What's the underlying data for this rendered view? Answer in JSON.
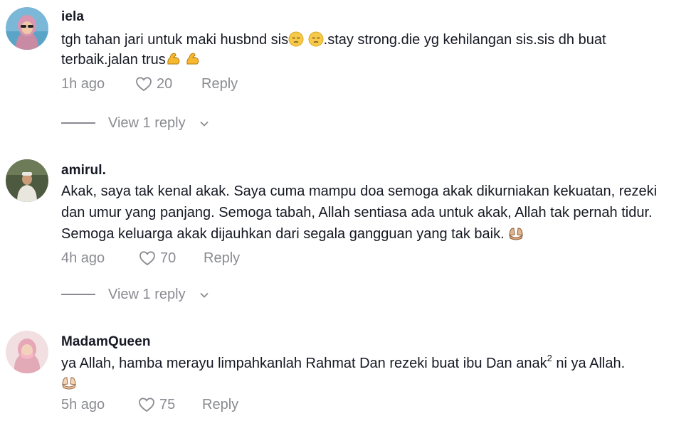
{
  "comments": [
    {
      "username": "iela",
      "text_part1": "tgh tahan jari untuk maki husbnd sis",
      "text_part2": ".stay strong.die yg kehilangan sis.sis dh buat terbaik.jalan trus",
      "time": "1h ago",
      "likes": "20",
      "reply_label": "Reply",
      "view_replies": "View 1 reply"
    },
    {
      "username": "amirul.",
      "text": "Akak, saya tak kenal akak. Saya cuma mampu doa semoga akak dikurniakan kekuatan, rezeki dan umur yang panjang. Semoga tabah, Allah sentiasa ada untuk akak, Allah tak pernah tidur. Semoga keluarga akak dijauhkan dari segala gangguan yang tak baik.",
      "time": "4h ago",
      "likes": "70",
      "reply_label": "Reply",
      "view_replies": "View 1 reply"
    },
    {
      "username": "MadamQueen",
      "text_part1": "ya Allah, hamba merayu limpahkanlah Rahmat Dan rezeki buat ibu Dan anak",
      "superscript": "2",
      "text_part2": " ni ya Allah.",
      "time": "5h ago",
      "likes": "75",
      "reply_label": "Reply"
    }
  ],
  "icons": {
    "like": "heart-outline-icon",
    "expand": "chevron-down-icon",
    "emoji_pensive": "pensive-face-emoji",
    "emoji_flexed": "flexed-biceps-emoji",
    "emoji_hands": "palms-up-together-emoji"
  },
  "colors": {
    "text": "#161823",
    "muted": "#8a8b91",
    "background": "#ffffff"
  }
}
